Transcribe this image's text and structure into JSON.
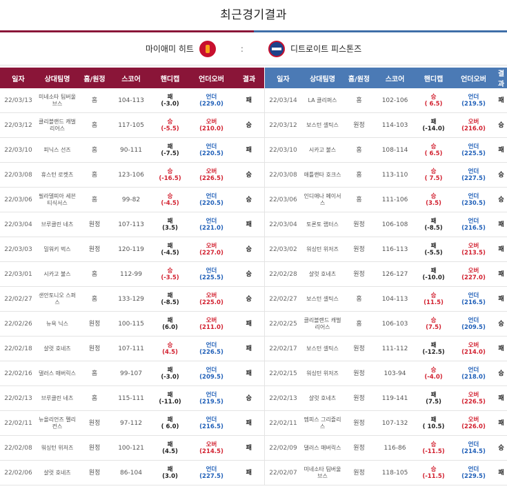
{
  "title": "최근경기결과",
  "matchup": {
    "home": "마이애미 히트",
    "vs": ":",
    "away": "디트로이트 피스톤즈"
  },
  "colors": {
    "heat": "#8a1538",
    "pistons": "#3f6ea8",
    "win": "#d2202f",
    "under": "#1f5fb8"
  },
  "headers": {
    "left": [
      "일자",
      "상대팀명",
      "홈/원정",
      "스코어",
      "핸디캡",
      "언더오버",
      "결과"
    ],
    "right": [
      "일자",
      "상대팀명",
      "홈/원정",
      "스코어",
      "핸디캡",
      "언더오버",
      "결과"
    ]
  },
  "heat_games": [
    {
      "date": "22/03/13",
      "opp": "미네소타 팀버울브스",
      "ha": "홈",
      "score": "104-113",
      "hc": "패",
      "hcv": "(-3.0)",
      "ou": "언더",
      "ouv": "(229.0)",
      "res": "패"
    },
    {
      "date": "22/03/12",
      "opp": "클리블랜드 캐벌리어스",
      "ha": "홈",
      "score": "117-105",
      "hc": "승",
      "hcv": "(-5.5)",
      "ou": "오버",
      "ouv": "(210.0)",
      "res": "승"
    },
    {
      "date": "22/03/10",
      "opp": "피닉스 선즈",
      "ha": "홈",
      "score": "90-111",
      "hc": "패",
      "hcv": "(-7.5)",
      "ou": "언더",
      "ouv": "(220.5)",
      "res": "패"
    },
    {
      "date": "22/03/08",
      "opp": "휴스턴 로켓츠",
      "ha": "홈",
      "score": "123-106",
      "hc": "승",
      "hcv": "(-16.5)",
      "ou": "오버",
      "ouv": "(226.5)",
      "res": "승"
    },
    {
      "date": "22/03/06",
      "opp": "필라델피아 세븐티식서스",
      "ha": "홈",
      "score": "99-82",
      "hc": "승",
      "hcv": "(-4.5)",
      "ou": "언더",
      "ouv": "(220.5)",
      "res": "승"
    },
    {
      "date": "22/03/04",
      "opp": "브루클린 네츠",
      "ha": "원정",
      "score": "107-113",
      "hc": "패",
      "hcv": "(3.5)",
      "ou": "언더",
      "ouv": "(221.0)",
      "res": "패"
    },
    {
      "date": "22/03/03",
      "opp": "밀워키 벅스",
      "ha": "원정",
      "score": "120-119",
      "hc": "패",
      "hcv": "(-4.5)",
      "ou": "오버",
      "ouv": "(227.0)",
      "res": "승"
    },
    {
      "date": "22/03/01",
      "opp": "시카고 불스",
      "ha": "홈",
      "score": "112-99",
      "hc": "승",
      "hcv": "(-3.5)",
      "ou": "언더",
      "ouv": "(225.5)",
      "res": "승"
    },
    {
      "date": "22/02/27",
      "opp": "샌안토니오 스퍼스",
      "ha": "홈",
      "score": "133-129",
      "hc": "패",
      "hcv": "(-8.5)",
      "ou": "오버",
      "ouv": "(225.0)",
      "res": "승"
    },
    {
      "date": "22/02/26",
      "opp": "뉴욕 닉스",
      "ha": "원정",
      "score": "100-115",
      "hc": "패",
      "hcv": "(6.0)",
      "ou": "오버",
      "ouv": "(211.0)",
      "res": "패"
    },
    {
      "date": "22/02/18",
      "opp": "샬럿 호네츠",
      "ha": "원정",
      "score": "107-111",
      "hc": "승",
      "hcv": "(4.5)",
      "ou": "언더",
      "ouv": "(226.5)",
      "res": "패"
    },
    {
      "date": "22/02/16",
      "opp": "댈러스 매버릭스",
      "ha": "홈",
      "score": "99-107",
      "hc": "패",
      "hcv": "(-3.0)",
      "ou": "언더",
      "ouv": "(209.5)",
      "res": "패"
    },
    {
      "date": "22/02/13",
      "opp": "브루클린 네츠",
      "ha": "홈",
      "score": "115-111",
      "hc": "패",
      "hcv": "(-11.0)",
      "ou": "언더",
      "ouv": "(219.5)",
      "res": "승"
    },
    {
      "date": "22/02/11",
      "opp": "뉴올리언즈 펠리컨스",
      "ha": "원정",
      "score": "97-112",
      "hc": "패",
      "hcv": "( 6.0)",
      "ou": "언더",
      "ouv": "(216.5)",
      "res": "패"
    },
    {
      "date": "22/02/08",
      "opp": "워싱턴 위저즈",
      "ha": "원정",
      "score": "100-121",
      "hc": "패",
      "hcv": "(4.5)",
      "ou": "오버",
      "ouv": "(214.5)",
      "res": "패"
    },
    {
      "date": "22/02/06",
      "opp": "샬럿 호네츠",
      "ha": "원정",
      "score": "86-104",
      "hc": "패",
      "hcv": "(3.0)",
      "ou": "언더",
      "ouv": "(227.5)",
      "res": "패"
    }
  ],
  "pistons_games": [
    {
      "date": "22/03/14",
      "opp": "LA 클리퍼스",
      "ha": "홈",
      "score": "102-106",
      "hc": "승",
      "hcv": "( 6.5)",
      "ou": "언더",
      "ouv": "(219.5)",
      "res": "패"
    },
    {
      "date": "22/03/12",
      "opp": "보스턴 셀틱스",
      "ha": "원정",
      "score": "114-103",
      "hc": "패",
      "hcv": "(-14.0)",
      "ou": "오버",
      "ouv": "(216.0)",
      "res": "승"
    },
    {
      "date": "22/03/10",
      "opp": "시카고 불스",
      "ha": "홈",
      "score": "108-114",
      "hc": "승",
      "hcv": "( 6.5)",
      "ou": "언더",
      "ouv": "(225.5)",
      "res": "패"
    },
    {
      "date": "22/03/08",
      "opp": "애틀랜타 호크스",
      "ha": "홈",
      "score": "113-110",
      "hc": "승",
      "hcv": "( 7.5)",
      "ou": "언더",
      "ouv": "(227.5)",
      "res": "승"
    },
    {
      "date": "22/03/06",
      "opp": "인디애나 페이서스",
      "ha": "홈",
      "score": "111-106",
      "hc": "승",
      "hcv": "(3.5)",
      "ou": "언더",
      "ouv": "(230.5)",
      "res": "승"
    },
    {
      "date": "22/03/04",
      "opp": "토론토 랩터스",
      "ha": "원정",
      "score": "106-108",
      "hc": "패",
      "hcv": "(-8.5)",
      "ou": "언더",
      "ouv": "(216.5)",
      "res": "패"
    },
    {
      "date": "22/03/02",
      "opp": "워싱턴 위저즈",
      "ha": "원정",
      "score": "116-113",
      "hc": "패",
      "hcv": "(-5.5)",
      "ou": "오버",
      "ouv": "(213.5)",
      "res": "패"
    },
    {
      "date": "22/02/28",
      "opp": "샬럿 호네츠",
      "ha": "원정",
      "score": "126-127",
      "hc": "패",
      "hcv": "(-10.0)",
      "ou": "오버",
      "ouv": "(227.0)",
      "res": "패"
    },
    {
      "date": "22/02/27",
      "opp": "보스턴 셀틱스",
      "ha": "홈",
      "score": "104-113",
      "hc": "승",
      "hcv": "(11.5)",
      "ou": "언더",
      "ouv": "(216.5)",
      "res": "패"
    },
    {
      "date": "22/02/25",
      "opp": "클리블랜드 캐벌리어스",
      "ha": "홈",
      "score": "106-103",
      "hc": "승",
      "hcv": "(7.5)",
      "ou": "언더",
      "ouv": "(209.5)",
      "res": "승"
    },
    {
      "date": "22/02/17",
      "opp": "보스턴 셀틱스",
      "ha": "원정",
      "score": "111-112",
      "hc": "패",
      "hcv": "(-12.5)",
      "ou": "오버",
      "ouv": "(214.0)",
      "res": "패"
    },
    {
      "date": "22/02/15",
      "opp": "워싱턴 위저즈",
      "ha": "원정",
      "score": "103-94",
      "hc": "승",
      "hcv": "(-4.0)",
      "ou": "언더",
      "ouv": "(218.0)",
      "res": "승"
    },
    {
      "date": "22/02/13",
      "opp": "샬럿 호네츠",
      "ha": "원정",
      "score": "119-141",
      "hc": "패",
      "hcv": "(7.5)",
      "ou": "오버",
      "ouv": "(226.5)",
      "res": "패"
    },
    {
      "date": "22/02/11",
      "opp": "멤피스 그리즐리스",
      "ha": "원정",
      "score": "107-132",
      "hc": "패",
      "hcv": "( 10.5)",
      "ou": "오버",
      "ouv": "(226.0)",
      "res": "패"
    },
    {
      "date": "22/02/09",
      "opp": "댈러스 매버릭스",
      "ha": "원정",
      "score": "116-86",
      "hc": "승",
      "hcv": "(-11.5)",
      "ou": "언더",
      "ouv": "(214.5)",
      "res": "승"
    },
    {
      "date": "22/02/07",
      "opp": "미네소타 팀버울브스",
      "ha": "원정",
      "score": "118-105",
      "hc": "승",
      "hcv": "(-11.5)",
      "ou": "언더",
      "ouv": "(229.5)",
      "res": "패"
    }
  ]
}
